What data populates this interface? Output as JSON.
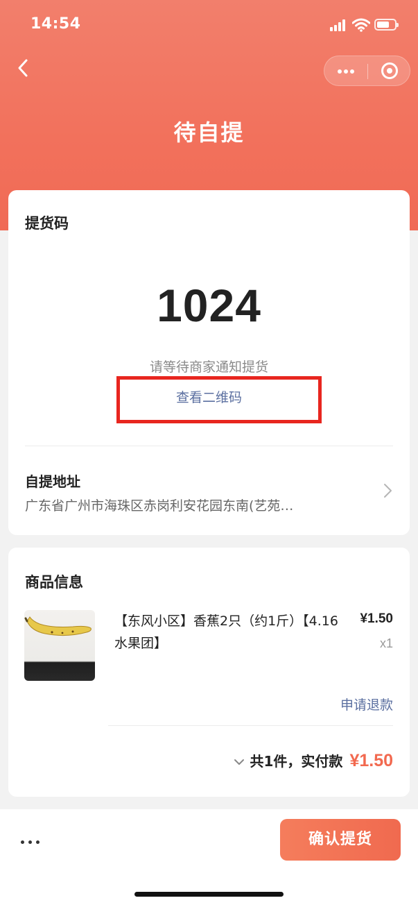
{
  "status_bar": {
    "time": "14:54"
  },
  "nav": {
    "title": "待自提"
  },
  "pickup": {
    "section_title": "提货码",
    "code": "1024",
    "hint": "请等待商家通知提货",
    "qr_link": "查看二维码"
  },
  "address": {
    "title": "自提地址",
    "text": "广东省广州市海珠区赤岗利安花园东南(艺苑…"
  },
  "goods": {
    "section_title": "商品信息",
    "items": [
      {
        "name": "【东风小区】香蕉2只（约1斤）【4.16水果团】",
        "price": "¥1.50",
        "qty": "x1"
      }
    ],
    "refund_label": "申请退款",
    "summary_text": "共1件，实付款",
    "summary_total": "¥1.50"
  },
  "bottom": {
    "confirm_label": "确认提货"
  },
  "colors": {
    "accent": "#f2715c",
    "link": "#5b6fa0",
    "price_highlight": "#f2694f",
    "annotation_box": "#e8261f"
  }
}
